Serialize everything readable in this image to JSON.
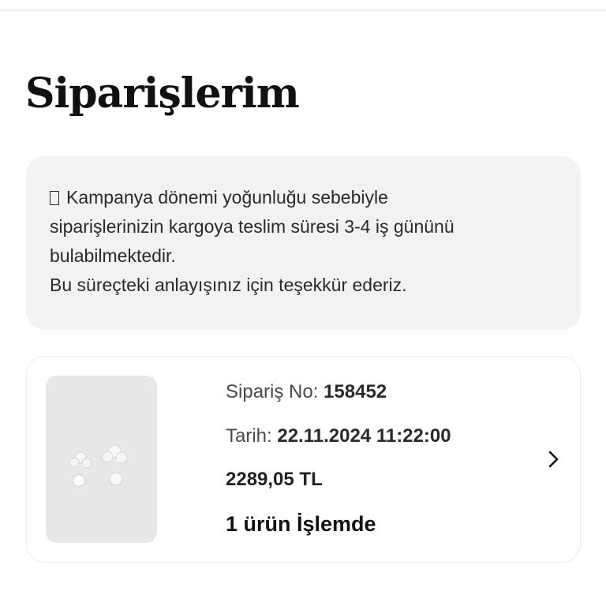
{
  "page": {
    "title": "Siparişlerim"
  },
  "notice": {
    "icon": "unknown-glyph-icon",
    "line1": "Kampanya dönemi yoğunluğu sebebiyle",
    "line2": "siparişlerinizin kargoya teslim süresi 3-4 iş gününü",
    "line3": "bulabilmektedir.",
    "line4": "Bu süreçteki anlayışınız için teşekkür ederiz."
  },
  "order": {
    "image_icon": "pearl-earrings-image",
    "order_no_label": "Sipariş No:",
    "order_no": "158452",
    "date_label": "Tarih:",
    "date": "22.11.2024 11:22:00",
    "total": "2289,05 TL",
    "status": "1 ürün İşlemde",
    "chevron_icon": "chevron-right-icon"
  }
}
